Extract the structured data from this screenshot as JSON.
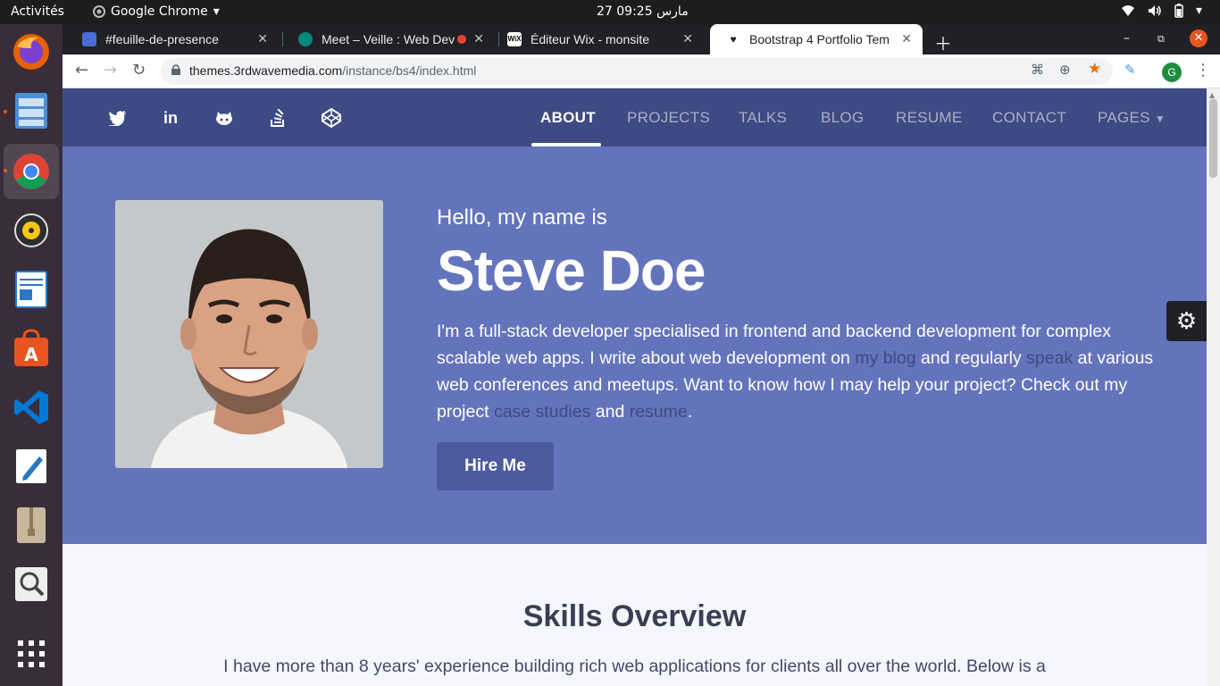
{
  "topbar": {
    "activities": "Activités",
    "app_name": "Google Chrome",
    "clock": "27 مارس  09:25"
  },
  "dock": {
    "items": [
      "firefox-icon",
      "files-icon",
      "chrome-icon",
      "rhythmbox-icon",
      "writer-icon",
      "software-icon",
      "vscode-icon",
      "text-editor-icon",
      "archive-icon",
      "search-magnifier-icon",
      "show-apps-icon"
    ]
  },
  "browser": {
    "tabs": [
      {
        "title": "#feuille-de-presence",
        "favicon_color": "#4a6bd6"
      },
      {
        "title": "Meet – Veille : Web Dev",
        "favicon_color": "#00897b"
      },
      {
        "title": "Éditeur Wix - monsite",
        "favicon_color": "#000000"
      },
      {
        "title": "Bootstrap 4 Portfolio Tem",
        "favicon_color": "#202124"
      }
    ],
    "url_host": "themes.3rdwavemedia.com",
    "url_path": "/instance/bs4/index.html",
    "avatar_letter": "G"
  },
  "site": {
    "colors": {
      "nav": "#3e4a83",
      "hero": "#6474bc",
      "button": "#4c5ba0"
    },
    "social": [
      "twitter-icon",
      "linkedin-icon",
      "github-icon",
      "stackoverflow-icon",
      "codepen-icon"
    ],
    "nav": {
      "about": "ABOUT",
      "projects": "PROJECTS",
      "talks": "TALKS",
      "blog": "BLOG",
      "resume": "RESUME",
      "contact": "CONTACT",
      "pages": "PAGES"
    },
    "hero": {
      "greeting": "Hello, my name is",
      "name": "Steve Doe",
      "bio_1": "I'm a full-stack developer specialised in frontend and backend development for complex scalable web apps. I write about web development on ",
      "link_blog": "my blog",
      "bio_2": " and regularly ",
      "link_speak": "speak",
      "bio_3": " at various web conferences and meetups. Want to know how I may help your project? Check out my project ",
      "link_case": "case studies",
      "bio_4": " and ",
      "link_resume": "resume",
      "bio_5": ".",
      "hire_button": "Hire Me"
    },
    "skills": {
      "title": "Skills Overview",
      "text": "I have more than 8 years' experience building rich web applications for clients all over the world. Below is a"
    }
  }
}
